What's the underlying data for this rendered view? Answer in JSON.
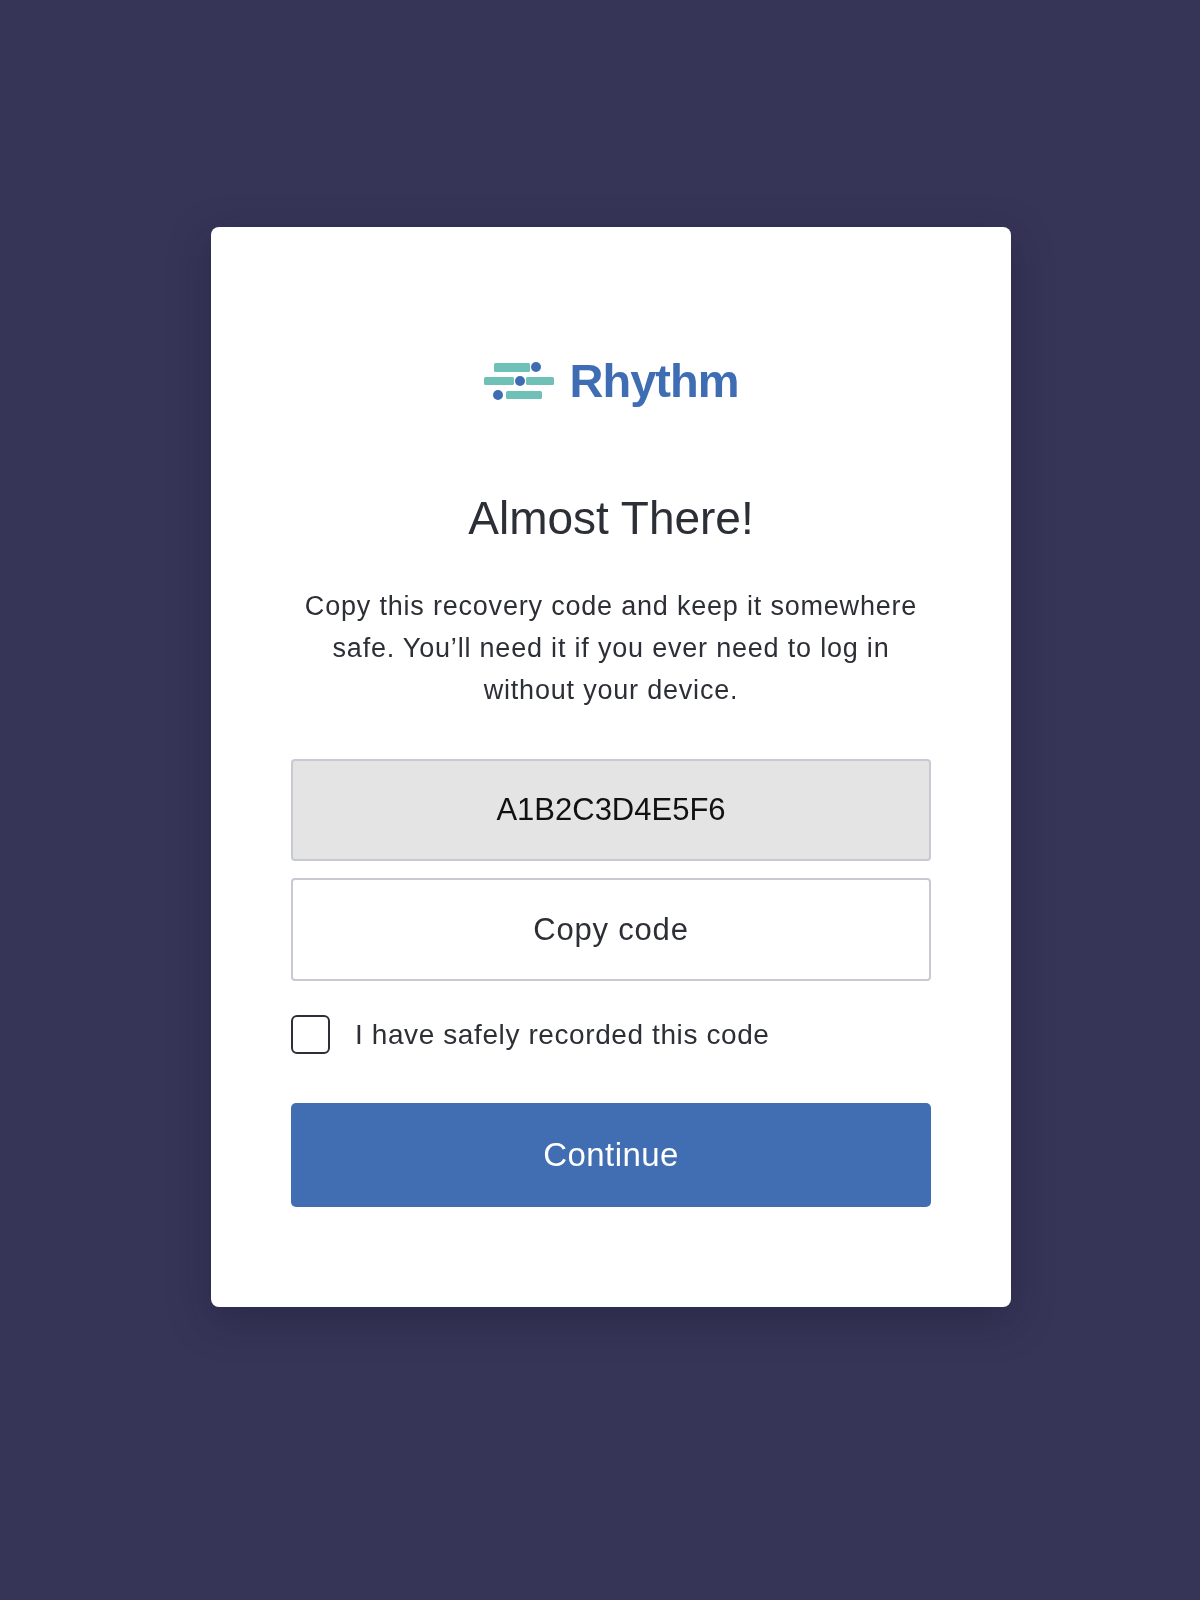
{
  "logo": {
    "text": "Rhythm"
  },
  "title": "Almost There!",
  "message": "Copy this recovery code and keep it somewhere safe. You’ll need it if you ever need to log in without your device.",
  "recovery_code": {
    "value": "A1B2C3D4E5F6"
  },
  "copy_button": {
    "label": "Copy code"
  },
  "confirm_checkbox": {
    "label": "I have safely recorded this code",
    "checked": false
  },
  "continue_button": {
    "label": "Continue"
  }
}
